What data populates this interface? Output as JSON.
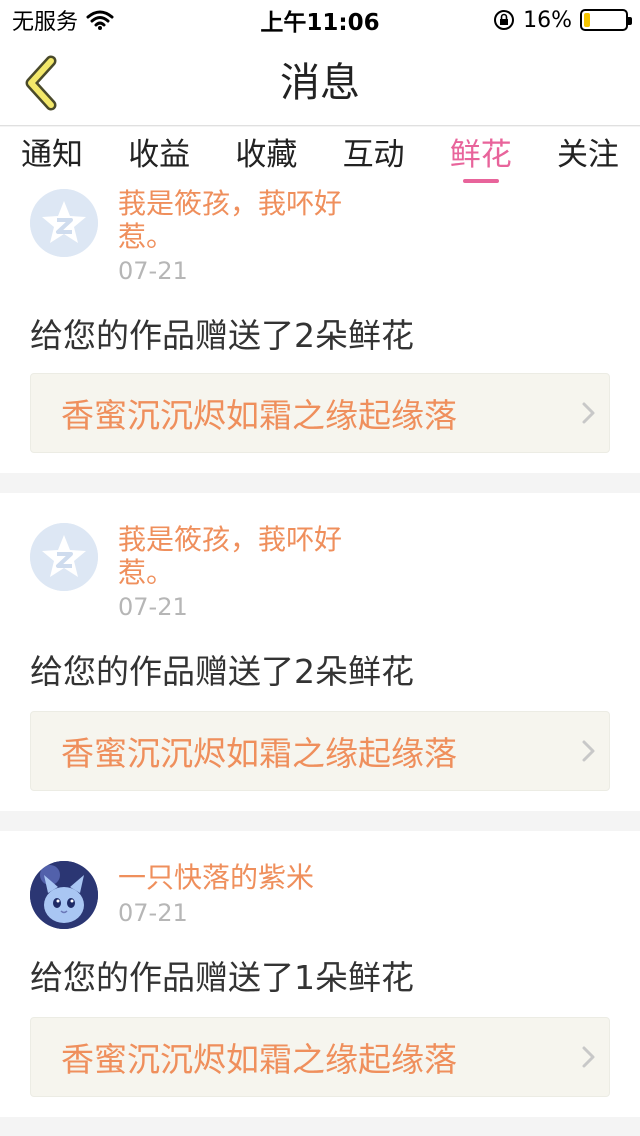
{
  "status_bar": {
    "carrier": "无服务",
    "time": "上午11:06",
    "battery_percent": "16%",
    "battery_level": 0.16
  },
  "nav": {
    "title": "消息",
    "back_icon": "chevron-left-icon"
  },
  "tabs": [
    {
      "label": "通知",
      "active": false
    },
    {
      "label": "收益",
      "active": false
    },
    {
      "label": "收藏",
      "active": false
    },
    {
      "label": "互动",
      "active": false
    },
    {
      "label": "鲜花",
      "active": true
    },
    {
      "label": "关注",
      "active": false
    }
  ],
  "colors": {
    "accent": "#e8649b",
    "name": "#ef8f5c",
    "link_bg": "#f6f5ee",
    "battery": "#f5c400"
  },
  "feed": [
    {
      "user": "莪是筱孩，莪吥好惹。",
      "user_line1": "莪是筱孩，莪吥好",
      "user_line2": "惹。",
      "date": "07-21",
      "message": "给您的作品赠送了2朵鲜花",
      "work": "香蜜沉沉烬如霜之缘起缘落",
      "avatar": "default-avatar-icon"
    },
    {
      "user": "莪是筱孩，莪吥好惹。",
      "user_line1": "莪是筱孩，莪吥好",
      "user_line2": "惹。",
      "date": "07-21",
      "message": "给您的作品赠送了2朵鲜花",
      "work": "香蜜沉沉烬如霜之缘起缘落",
      "avatar": "default-avatar-icon"
    },
    {
      "user": "一只快落的紫米",
      "date": "07-21",
      "message": "给您的作品赠送了1朵鲜花",
      "work": "香蜜沉沉烬如霜之缘起缘落",
      "avatar": "cat-avatar"
    }
  ]
}
